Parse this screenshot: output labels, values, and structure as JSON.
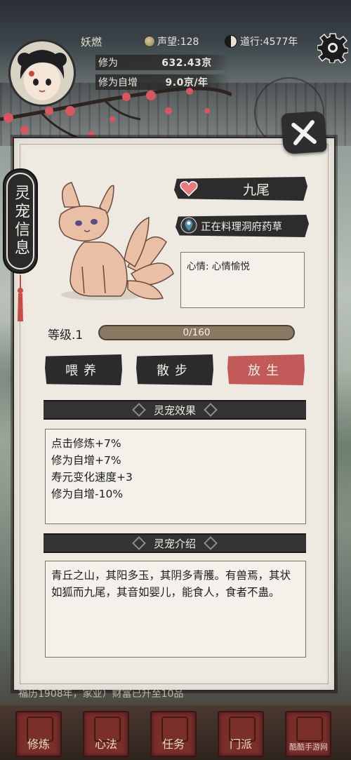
{
  "player": {
    "name": "妖燃",
    "reputation_label": "声望:128",
    "dao_label": "道行:4577年",
    "cultivation_label": "修为",
    "cultivation_value": "632.43京",
    "auto_gain_label": "修为自增",
    "auto_gain_value": "9.0京/年"
  },
  "panel": {
    "side_tab": "灵宠信息",
    "pet_name": "九尾",
    "location": "正在料理洞府药草",
    "mood": "心情: 心情愉悦",
    "level_label": "等级.1",
    "exp_text": "0/160",
    "exp_progress": 0.0,
    "buttons": {
      "feed": "喂养",
      "walk": "散步",
      "release": "放生"
    },
    "effects_title": "灵宠效果",
    "effects": [
      "点击修炼+7%",
      "修为自增+7%",
      "寿元变化速度+3",
      "修为自增-10%"
    ],
    "intro_title": "灵宠介绍",
    "intro_text": "青丘之山，其阳多玉，其阴多青雘。有兽焉，其状如狐而九尾，其音如婴儿，能食人，食者不蛊。"
  },
  "bottom_hint": "福历1908年，家业）财富已升至10品",
  "nav": {
    "items": [
      "修炼",
      "心法",
      "任务",
      "门派",
      ""
    ]
  },
  "watermark": "酷酷手游网",
  "colors": {
    "release_button": "#c25a5a",
    "heart": "#e8797f",
    "pin": "#4f8fb5"
  },
  "icons": [
    "gear-icon",
    "close-icon",
    "heart-icon",
    "location-pin-icon",
    "coin-icon",
    "taiji-icon"
  ]
}
